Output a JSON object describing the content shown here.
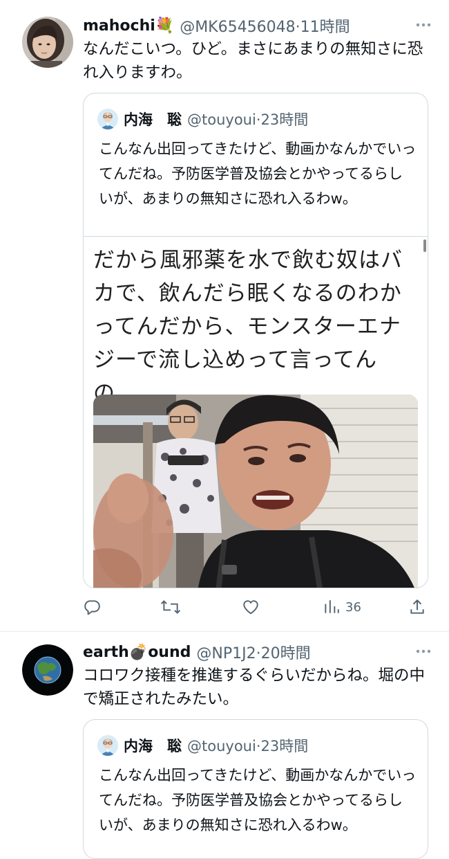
{
  "tweets": [
    {
      "display_name": "mahochi💐",
      "handle": "@MK65456048",
      "time": "11時間",
      "text": "なんだこいつ。ひど。まさにあまりの無知さに恐れ入りますわ。",
      "quote": {
        "display_name": "内海　聡",
        "handle": "@touyoui",
        "time": "23時間",
        "text": "こんなん出回ってきたけど、動画かなんかでいってんだね。予防医学普及協会とかやってるらしいが、あまりの無知さに恐れ入るわw。",
        "media_caption": "だから風邪薬を水で飲む奴はバカで、飲んだら眠くなるのわかってんだから、モンスターエナジーで流し込めって言ってんの。"
      },
      "actions": {
        "views_count": "36"
      }
    },
    {
      "display_name": "earth💣ound",
      "handle": "@NP1J2",
      "time": "20時間",
      "text": "コロワク接種を推進するぐらいだからね。堀の中で矯正されたみたい。",
      "quote": {
        "display_name": "内海　聡",
        "handle": "@touyoui",
        "time": "23時間",
        "text": "こんなん出回ってきたけど、動画かなんかでいってんだね。予防医学普及協会とかやってるらしいが、あまりの無知さに恐れ入るわw。"
      }
    }
  ],
  "meta_separator": "·",
  "colors": {
    "text": "#0f1419",
    "secondary": "#536471",
    "border": "#cfd9de"
  }
}
